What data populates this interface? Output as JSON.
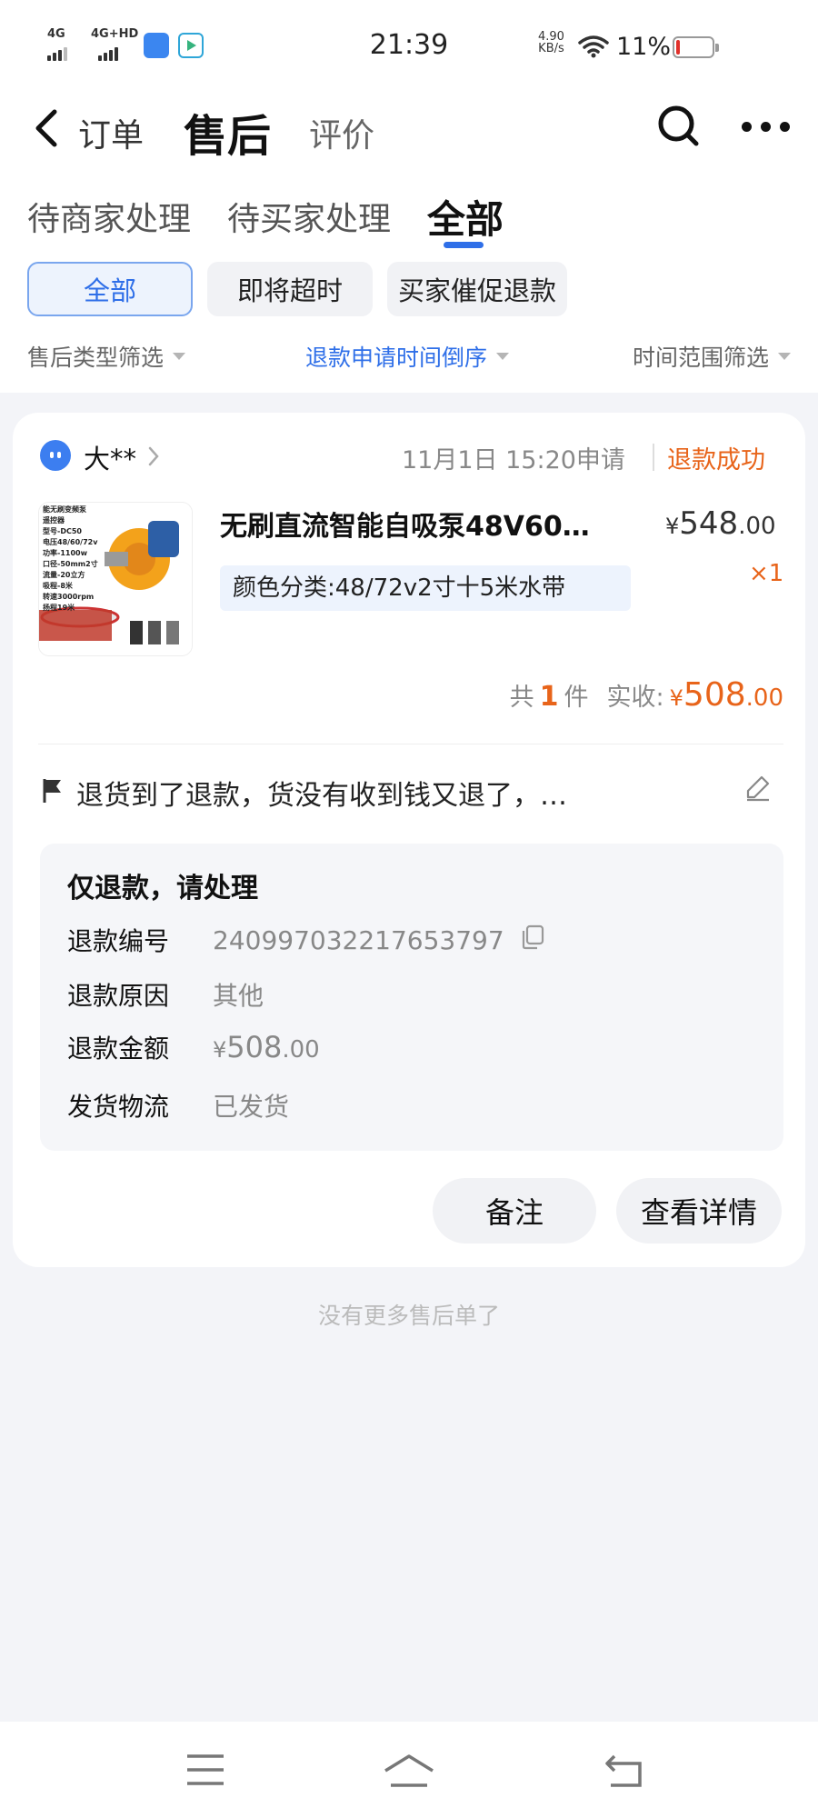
{
  "status_bar": {
    "sim1": "4G",
    "sim2": "4G+HD",
    "time": "21:39",
    "net_speed_value": "4.90",
    "net_speed_unit": "KB/s",
    "battery_pct": "11%",
    "battery_level": 0.11,
    "battery_color": "#e0302a"
  },
  "nav": {
    "orders": "订单",
    "after_sales": "售后",
    "reviews": "评价"
  },
  "tabs": [
    "待商家处理",
    "待买家处理",
    "全部"
  ],
  "chips": [
    "全部",
    "即将超时",
    "买家催促退款"
  ],
  "filters": {
    "type": "售后类型筛选",
    "sort": "退款申请时间倒序",
    "range": "时间范围筛选"
  },
  "card": {
    "seller": "大**",
    "apply_time": "11月1日 15:20申请",
    "refund_status": "退款成功",
    "product": {
      "name": "无刷直流智能自吸泵48V60…",
      "price_symbol": "¥",
      "price_int": "548",
      "price_dec": ".00",
      "sku": "颜色分类:48/72v2寸十5米水带",
      "qty": "×1",
      "thumb_lines": [
        "能无刷变频泵",
        "遥控器",
        "型号-DC50",
        "电压48/60/72v",
        "功率-1100w",
        "口径-50mm2寸",
        "流量-20立方",
        "吸程-8米",
        "转速3000rpm",
        "扬程19米"
      ]
    },
    "summary": {
      "prefix": "共",
      "count": "1",
      "unit": "件",
      "received_label": "实收:",
      "symbol": "¥",
      "total_int": "508",
      "total_dec": ".00"
    },
    "remark": "退货到了退款，货没有收到钱又退了，…",
    "info": {
      "title": "仅退款，请处理",
      "rows": [
        {
          "key": "退款编号",
          "value": "240997032217653797"
        },
        {
          "key": "退款原因",
          "value": "其他"
        },
        {
          "key": "退款金额",
          "symbol": "¥",
          "int": "508",
          "dec": ".00"
        },
        {
          "key": "发货物流",
          "value": "已发货"
        }
      ]
    },
    "buttons": {
      "note": "备注",
      "detail": "查看详情"
    }
  },
  "footer": {
    "no_more": "没有更多售后单了"
  },
  "colors": {
    "accent_blue": "#2f6fe8",
    "accent_orange": "#e8641a",
    "background": "#f3f4f8"
  },
  "icons": [
    "back-chevron-icon",
    "search-icon",
    "more-dots-icon",
    "flag-icon",
    "edit-pencil-icon",
    "copy-icon",
    "menu-icon",
    "home-icon",
    "return-icon"
  ]
}
